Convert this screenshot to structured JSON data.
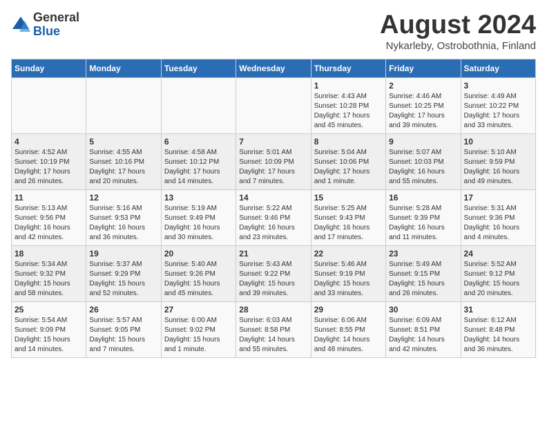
{
  "logo": {
    "general": "General",
    "blue": "Blue"
  },
  "title": "August 2024",
  "subtitle": "Nykarleby, Ostrobothnia, Finland",
  "days_of_week": [
    "Sunday",
    "Monday",
    "Tuesday",
    "Wednesday",
    "Thursday",
    "Friday",
    "Saturday"
  ],
  "weeks": [
    [
      {
        "day": "",
        "info": ""
      },
      {
        "day": "",
        "info": ""
      },
      {
        "day": "",
        "info": ""
      },
      {
        "day": "",
        "info": ""
      },
      {
        "day": "1",
        "info": "Sunrise: 4:43 AM\nSunset: 10:28 PM\nDaylight: 17 hours and 45 minutes."
      },
      {
        "day": "2",
        "info": "Sunrise: 4:46 AM\nSunset: 10:25 PM\nDaylight: 17 hours and 39 minutes."
      },
      {
        "day": "3",
        "info": "Sunrise: 4:49 AM\nSunset: 10:22 PM\nDaylight: 17 hours and 33 minutes."
      }
    ],
    [
      {
        "day": "4",
        "info": "Sunrise: 4:52 AM\nSunset: 10:19 PM\nDaylight: 17 hours and 26 minutes."
      },
      {
        "day": "5",
        "info": "Sunrise: 4:55 AM\nSunset: 10:16 PM\nDaylight: 17 hours and 20 minutes."
      },
      {
        "day": "6",
        "info": "Sunrise: 4:58 AM\nSunset: 10:12 PM\nDaylight: 17 hours and 14 minutes."
      },
      {
        "day": "7",
        "info": "Sunrise: 5:01 AM\nSunset: 10:09 PM\nDaylight: 17 hours and 7 minutes."
      },
      {
        "day": "8",
        "info": "Sunrise: 5:04 AM\nSunset: 10:06 PM\nDaylight: 17 hours and 1 minute."
      },
      {
        "day": "9",
        "info": "Sunrise: 5:07 AM\nSunset: 10:03 PM\nDaylight: 16 hours and 55 minutes."
      },
      {
        "day": "10",
        "info": "Sunrise: 5:10 AM\nSunset: 9:59 PM\nDaylight: 16 hours and 49 minutes."
      }
    ],
    [
      {
        "day": "11",
        "info": "Sunrise: 5:13 AM\nSunset: 9:56 PM\nDaylight: 16 hours and 42 minutes."
      },
      {
        "day": "12",
        "info": "Sunrise: 5:16 AM\nSunset: 9:53 PM\nDaylight: 16 hours and 36 minutes."
      },
      {
        "day": "13",
        "info": "Sunrise: 5:19 AM\nSunset: 9:49 PM\nDaylight: 16 hours and 30 minutes."
      },
      {
        "day": "14",
        "info": "Sunrise: 5:22 AM\nSunset: 9:46 PM\nDaylight: 16 hours and 23 minutes."
      },
      {
        "day": "15",
        "info": "Sunrise: 5:25 AM\nSunset: 9:43 PM\nDaylight: 16 hours and 17 minutes."
      },
      {
        "day": "16",
        "info": "Sunrise: 5:28 AM\nSunset: 9:39 PM\nDaylight: 16 hours and 11 minutes."
      },
      {
        "day": "17",
        "info": "Sunrise: 5:31 AM\nSunset: 9:36 PM\nDaylight: 16 hours and 4 minutes."
      }
    ],
    [
      {
        "day": "18",
        "info": "Sunrise: 5:34 AM\nSunset: 9:32 PM\nDaylight: 15 hours and 58 minutes."
      },
      {
        "day": "19",
        "info": "Sunrise: 5:37 AM\nSunset: 9:29 PM\nDaylight: 15 hours and 52 minutes."
      },
      {
        "day": "20",
        "info": "Sunrise: 5:40 AM\nSunset: 9:26 PM\nDaylight: 15 hours and 45 minutes."
      },
      {
        "day": "21",
        "info": "Sunrise: 5:43 AM\nSunset: 9:22 PM\nDaylight: 15 hours and 39 minutes."
      },
      {
        "day": "22",
        "info": "Sunrise: 5:46 AM\nSunset: 9:19 PM\nDaylight: 15 hours and 33 minutes."
      },
      {
        "day": "23",
        "info": "Sunrise: 5:49 AM\nSunset: 9:15 PM\nDaylight: 15 hours and 26 minutes."
      },
      {
        "day": "24",
        "info": "Sunrise: 5:52 AM\nSunset: 9:12 PM\nDaylight: 15 hours and 20 minutes."
      }
    ],
    [
      {
        "day": "25",
        "info": "Sunrise: 5:54 AM\nSunset: 9:09 PM\nDaylight: 15 hours and 14 minutes."
      },
      {
        "day": "26",
        "info": "Sunrise: 5:57 AM\nSunset: 9:05 PM\nDaylight: 15 hours and 7 minutes."
      },
      {
        "day": "27",
        "info": "Sunrise: 6:00 AM\nSunset: 9:02 PM\nDaylight: 15 hours and 1 minute."
      },
      {
        "day": "28",
        "info": "Sunrise: 6:03 AM\nSunset: 8:58 PM\nDaylight: 14 hours and 55 minutes."
      },
      {
        "day": "29",
        "info": "Sunrise: 6:06 AM\nSunset: 8:55 PM\nDaylight: 14 hours and 48 minutes."
      },
      {
        "day": "30",
        "info": "Sunrise: 6:09 AM\nSunset: 8:51 PM\nDaylight: 14 hours and 42 minutes."
      },
      {
        "day": "31",
        "info": "Sunrise: 6:12 AM\nSunset: 8:48 PM\nDaylight: 14 hours and 36 minutes."
      }
    ]
  ]
}
